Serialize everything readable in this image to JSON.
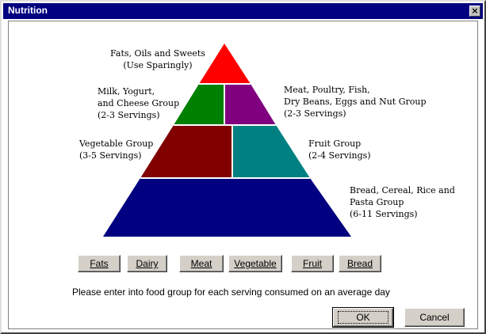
{
  "window": {
    "title": "Nutrition",
    "close_glyph": "×"
  },
  "pyramid": {
    "colors": {
      "fats": "#ff0000",
      "dairy": "#008000",
      "meat": "#800080",
      "vegetable": "#800000",
      "fruit": "#008080",
      "bread": "#000080",
      "divider": "#ffffff"
    },
    "labels": {
      "fats": [
        "Fats, Oils and Sweets",
        "(Use Sparingly)"
      ],
      "dairy": [
        "Milk, Yogurt,",
        "and Cheese Group",
        "(2-3 Servings)"
      ],
      "meat": [
        "Meat, Poultry, Fish,",
        "Dry Beans, Eggs and Nut Group",
        "(2-3 Servings)"
      ],
      "vegetable": [
        "Vegetable Group",
        "(3-5 Servings)"
      ],
      "fruit": [
        "Fruit Group",
        "(2-4 Servings)"
      ],
      "bread": [
        "Bread, Cereal, Rice and",
        "Pasta Group",
        "(6-11 Servings)"
      ]
    }
  },
  "group_buttons": [
    "Fats",
    "Dairy",
    "Meat",
    "Vegetable",
    "Fruit",
    "Bread"
  ],
  "instruction": "Please enter into food group for each serving consumed on an average day",
  "dialog_buttons": {
    "ok": "OK",
    "cancel": "Cancel"
  }
}
